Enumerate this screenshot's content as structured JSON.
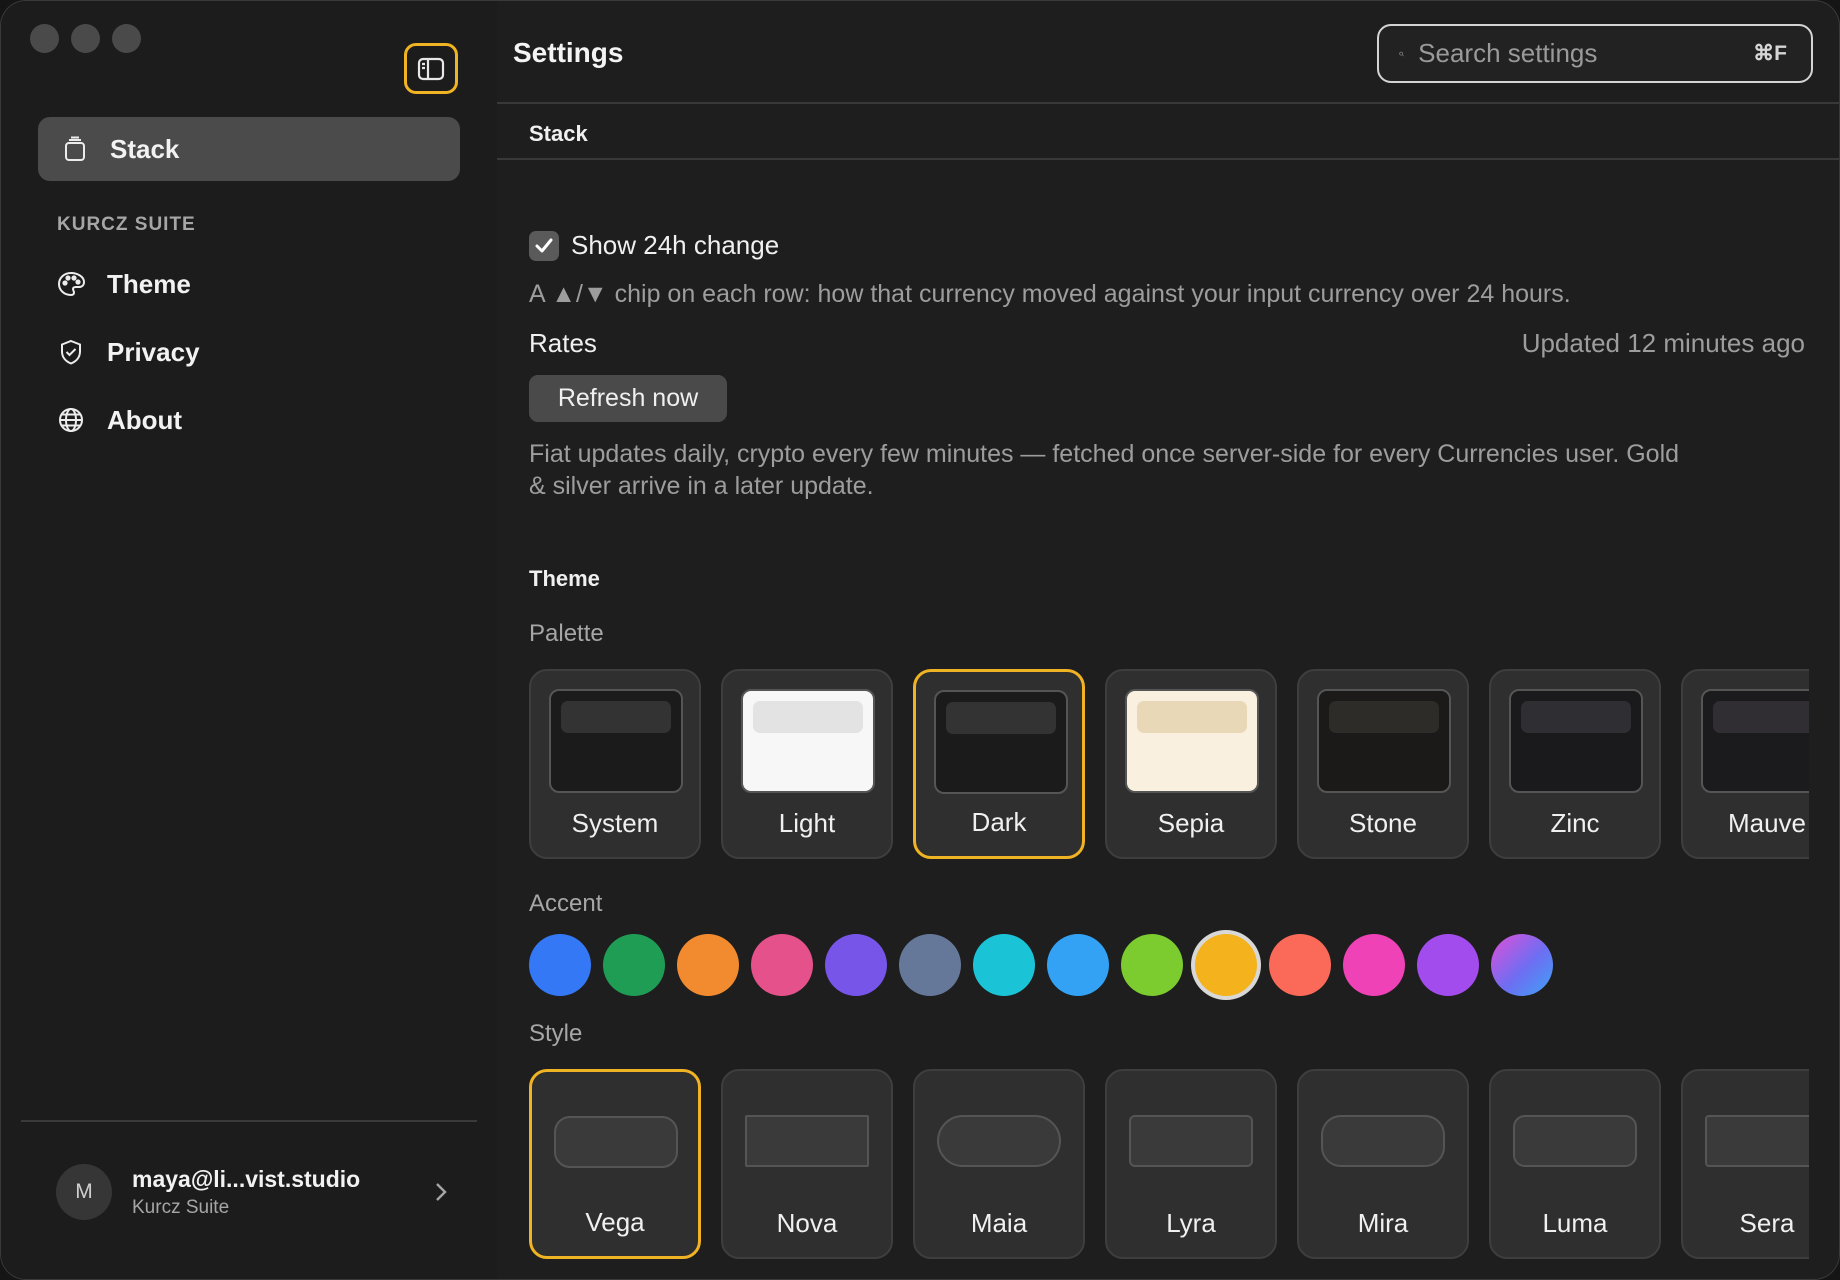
{
  "app": {
    "sidebar": {
      "active_item": {
        "label": "Stack",
        "icon": "stack-icon"
      },
      "section_heading": "KURCZ SUITE",
      "items": [
        {
          "label": "Theme",
          "icon": "palette-icon"
        },
        {
          "label": "Privacy",
          "icon": "shield-check-icon"
        },
        {
          "label": "About",
          "icon": "globe-icon"
        }
      ],
      "account": {
        "avatar_initial": "M",
        "email": "maya@li...vist.studio",
        "org": "Kurcz Suite"
      }
    },
    "header": {
      "title": "Settings",
      "search_placeholder": "Search settings",
      "search_shortcut": "⌘F"
    },
    "stack_section": {
      "heading": "Stack",
      "show_change": {
        "label": "Show 24h change",
        "checked": true
      },
      "show_change_help": "A ▲/▼ chip on each row: how that currency moved against your input currency over 24 hours.",
      "rates_label": "Rates",
      "rates_updated": "Updated 12 minutes ago",
      "refresh_label": "Refresh now",
      "rates_help_1": "Fiat updates daily, crypto every few minutes — fetched once server-side for every Currencies user. Gold",
      "rates_help_2": "& silver arrive in a later update."
    },
    "theme_section": {
      "heading": "Theme",
      "palette_label": "Palette",
      "palettes": [
        {
          "label": "System",
          "bg": "#1b1b1b",
          "bar": "#333333",
          "selected": false
        },
        {
          "label": "Light",
          "bg": "#f7f7f7",
          "bar": "#e3e3e3",
          "selected": false
        },
        {
          "label": "Dark",
          "bg": "#1b1b1b",
          "bar": "#333333",
          "selected": true
        },
        {
          "label": "Sepia",
          "bg": "#faf0df",
          "bar": "#e8d8b8",
          "selected": false
        },
        {
          "label": "Stone",
          "bg": "#1c1a18",
          "bar": "#2e2c29",
          "selected": false
        },
        {
          "label": "Zinc",
          "bg": "#1a1a1d",
          "bar": "#2e2e33",
          "selected": false
        },
        {
          "label": "Mauve",
          "bg": "#1b1a1d",
          "bar": "#302d33",
          "selected": false
        }
      ],
      "accent_label": "Accent",
      "accents": [
        {
          "name": "blue",
          "color": "#3478f6"
        },
        {
          "name": "green",
          "color": "#1f9d55"
        },
        {
          "name": "orange",
          "color": "#f28b30"
        },
        {
          "name": "pink",
          "color": "#e5518a"
        },
        {
          "name": "indigo",
          "color": "#7655e8"
        },
        {
          "name": "slate",
          "color": "#66789a"
        },
        {
          "name": "cyan",
          "color": "#1bc3d6"
        },
        {
          "name": "sky",
          "color": "#33a2f5"
        },
        {
          "name": "lime",
          "color": "#7ccb2f"
        },
        {
          "name": "amber",
          "color": "#f4b21c",
          "selected": true
        },
        {
          "name": "coral",
          "color": "#fb6a59"
        },
        {
          "name": "magenta",
          "color": "#ee42b6"
        },
        {
          "name": "purple",
          "color": "#a34ced"
        },
        {
          "name": "gradient",
          "color": "linear-gradient(135deg,#e04fd8,#6d6ef2 55%,#3fa2f5)"
        }
      ],
      "style_label": "Style",
      "styles": [
        {
          "label": "Vega",
          "radius": "16px",
          "selected": true
        },
        {
          "label": "Nova",
          "radius": "2px",
          "selected": false
        },
        {
          "label": "Maia",
          "radius": "26px",
          "selected": false
        },
        {
          "label": "Lyra",
          "radius": "6px",
          "selected": false
        },
        {
          "label": "Mira",
          "radius": "20px",
          "selected": false
        },
        {
          "label": "Luma",
          "radius": "12px",
          "selected": false
        },
        {
          "label": "Sera",
          "radius": "4px",
          "selected": false
        }
      ]
    },
    "colors": {
      "accent": "#f0b324"
    }
  }
}
